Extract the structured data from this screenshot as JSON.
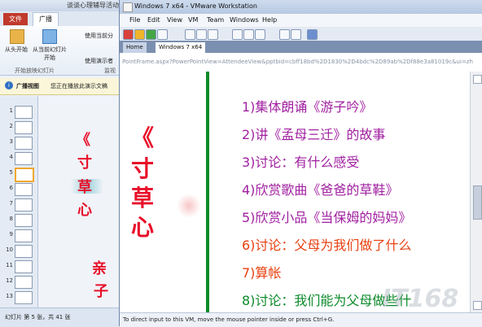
{
  "ppt": {
    "title": "谈谈心理辅导活动",
    "file_tab": "文件",
    "broadcast_tab": "广播",
    "ribbon": {
      "from_start": "从头开始",
      "from_current": "从当前幻灯片",
      "start": "开始",
      "use_current": "使用当前分",
      "use_presenter": "使用演示者",
      "group_label": "开始放映幻灯片",
      "monitor": "监视"
    },
    "info_label": "广播视图",
    "info_text": "您正在播放此演示文稿",
    "thumb_numbers": [
      "1",
      "2",
      "3",
      "4",
      "5",
      "6",
      "7",
      "8",
      "9",
      "10",
      "11",
      "12",
      "13"
    ],
    "slide_text": [
      "《",
      "寸",
      "草",
      "心",
      "亲",
      "子"
    ],
    "status": "幻灯片 第 5 张，共 41 张"
  },
  "vm": {
    "title": "Windows 7 x64 - VMware Workstation",
    "menus": [
      "File",
      "Edit",
      "View",
      "VM",
      "Team",
      "Windows",
      "Help"
    ],
    "tabs": {
      "home": "Home",
      "vm": "Windows 7 x64"
    },
    "address": "PointFrame.aspx?PowerPointView=AttendeeView&pptbid=cbff18bd%2D1830%2D4bdc%2D89ab%2Df88e3a81019c&ui=zh",
    "slide": {
      "title_chars": [
        "《",
        "寸",
        "草",
        "心"
      ],
      "items": [
        {
          "text": "1)集体朗诵《游子吟》",
          "color": "#a020a0"
        },
        {
          "text": "2)讲《孟母三迁》的故事",
          "color": "#a020a0"
        },
        {
          "text": "3)讨论：有什么感受",
          "color": "#a020a0"
        },
        {
          "text": "4)欣赏歌曲《爸爸的草鞋》",
          "color": "#a020a0"
        },
        {
          "text": "5)欣赏小品《当保姆的妈妈》",
          "color": "#a020a0"
        },
        {
          "text": "6)讨论：父母为我们做了什么",
          "color": "#e84010"
        },
        {
          "text": "7)算帐",
          "color": "#e84010"
        },
        {
          "text": "8)讨论：我们能为父母做些什",
          "color": "#0c8a2a"
        }
      ]
    },
    "status": "To direct input to this VM, move the mouse pointer inside or press Ctrl+G.",
    "watermark": "IT168"
  }
}
